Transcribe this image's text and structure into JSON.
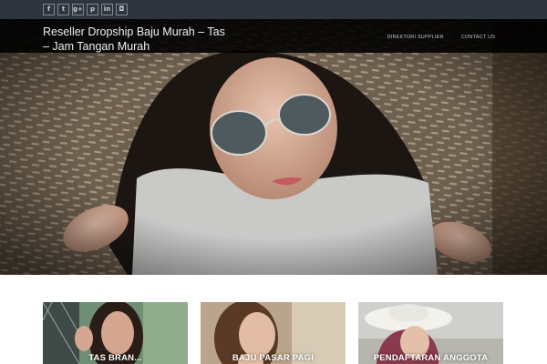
{
  "social": {
    "items": [
      {
        "icon": "facebook-icon",
        "glyph": "f"
      },
      {
        "icon": "twitter-icon",
        "glyph": "t"
      },
      {
        "icon": "google-plus-icon",
        "glyph": "g+"
      },
      {
        "icon": "pinterest-icon",
        "glyph": "p"
      },
      {
        "icon": "linkedin-icon",
        "glyph": "in"
      },
      {
        "icon": "instagram-icon",
        "glyph": "◘"
      }
    ]
  },
  "header": {
    "site_title": "Reseller Dropship Baju Murah – Tas – Jam Tangan Murah",
    "tagline": "",
    "nav": [
      {
        "label": "DIREKTORI SUPPLIER"
      },
      {
        "label": "CONTACT US"
      }
    ]
  },
  "cards": [
    {
      "label": "TAS BRAN..."
    },
    {
      "label": "BAJU PASAR PAGI"
    },
    {
      "label": "PENDAFTARAN ANGGOTA"
    }
  ],
  "colors": {
    "topbar": "#2e353d",
    "header_overlay": "#000000",
    "page_bg": "#ffffff"
  }
}
